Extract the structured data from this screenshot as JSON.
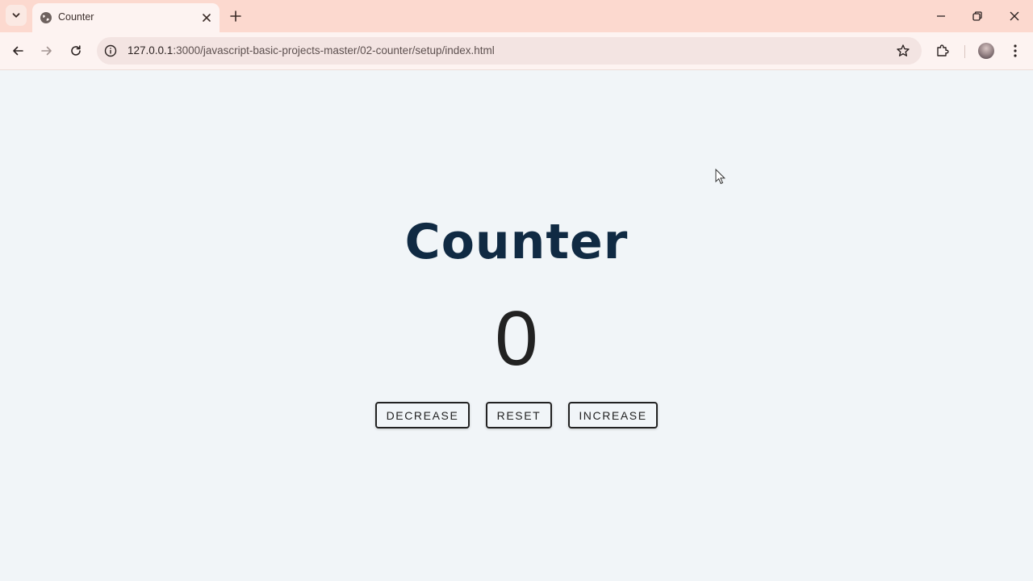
{
  "browser": {
    "tab_title": "Counter",
    "url_host": "127.0.0.1",
    "url_path": ":3000/javascript-basic-projects-master/02-counter/setup/index.html"
  },
  "icons": {
    "tab_search": "chevron-down-icon",
    "favicon": "globe-icon",
    "tab_close": "close-icon",
    "new_tab": "plus-icon",
    "minimize": "minimize-icon",
    "restore": "restore-icon",
    "close_window": "close-icon",
    "back": "back-arrow-icon",
    "forward": "forward-arrow-icon",
    "reload": "reload-icon",
    "site_info": "info-icon",
    "bookmark": "star-icon",
    "extensions": "puzzle-icon",
    "menu": "kebab-menu-icon"
  },
  "page": {
    "title": "Counter",
    "value": "0",
    "buttons": {
      "decrease": "decrease",
      "reset": "reset",
      "increase": "increase"
    }
  },
  "colors": {
    "tabbar_bg": "#fcd9cf",
    "toolbar_bg": "#fdf3f1",
    "page_bg": "#f1f5f8",
    "title_color": "#102a43",
    "value_color": "#222222"
  }
}
